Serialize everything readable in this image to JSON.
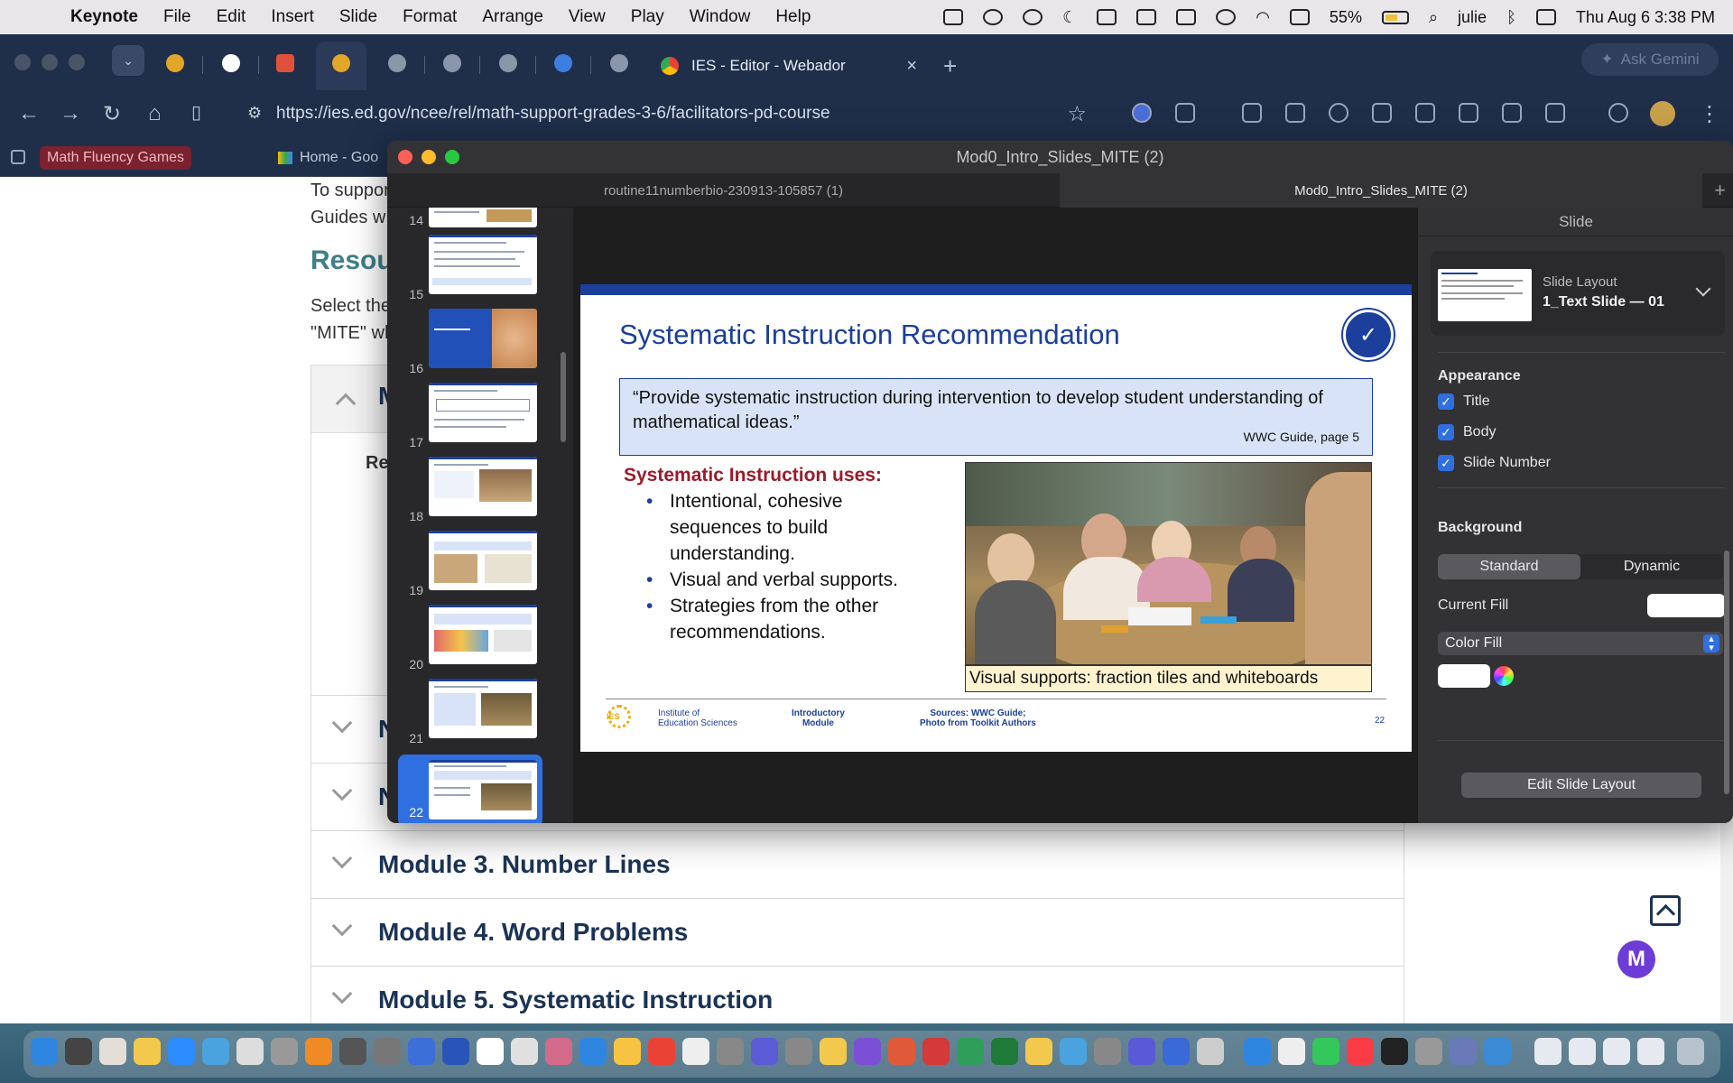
{
  "menubar": {
    "app": "Keynote",
    "items": [
      "File",
      "Edit",
      "Insert",
      "Slide",
      "Format",
      "Arrange",
      "View",
      "Play",
      "Window",
      "Help"
    ],
    "battery": "55%",
    "user": "julie",
    "datetime": "Thu Aug 6  3:38 PM"
  },
  "browser": {
    "active_tab_title": "IES - Editor - Webador",
    "ask_gemini": "Ask Gemini",
    "url": "https://ies.ed.gov/ncee/rel/math-support-grades-3-6/facilitators-pd-course",
    "bookmarks": [
      "Math Fluency Games",
      "Home - Goo"
    ]
  },
  "webpage": {
    "intro_line1": "To suppor",
    "intro_line2": "Guides w",
    "resources_heading": "Resou",
    "select_line1": "Select the",
    "select_line2": "\"MITE\" wh",
    "open_accordion_initial": "M",
    "open_body_initial": "Re",
    "collapsed_initials": [
      "N",
      "N"
    ],
    "modules": [
      "Module 3. Number Lines",
      "Module 4. Word Problems",
      "Module 5. Systematic Instruction"
    ],
    "help_bubble": "M"
  },
  "keynote": {
    "window_title": "Mod0_Intro_Slides_MITE (2)",
    "tabs": [
      "routine11numberbio-230913-105857 (1)",
      "Mod0_Intro_Slides_MITE (2)"
    ],
    "slide_numbers": [
      "14",
      "15",
      "16",
      "17",
      "18",
      "19",
      "20",
      "21",
      "22"
    ],
    "selected_slide": "22",
    "slide": {
      "title": "Systematic Instruction Recommendation",
      "quote": "“Provide systematic instruction during intervention to develop student understanding of mathematical ideas.”",
      "quote_source": "WWC Guide, page 5",
      "uses_heading": "Systematic Instruction uses:",
      "bullets": [
        "Intentional, cohesive sequences to build understanding.",
        "Visual and verbal supports.",
        "Strategies from the other recommendations."
      ],
      "photo_caption": "Visual supports: fraction tiles and whiteboards",
      "footer_logo_abbr": "IES",
      "footer_org": "Institute of\nEducation Sciences",
      "footer_module": "Introductory\nModule",
      "footer_sources": "Sources: WWC Guide;\nPhoto from Toolkit Authors",
      "page_number": "22"
    },
    "inspector": {
      "header": "Slide",
      "layout_label": "Slide Layout",
      "layout_value": "1_Text Slide — 01",
      "appearance": "Appearance",
      "checks": [
        "Title",
        "Body",
        "Slide Number"
      ],
      "background": "Background",
      "seg": [
        "Standard",
        "Dynamic"
      ],
      "current_fill": "Current Fill",
      "fill_type": "Color Fill",
      "edit_layout": "Edit Slide Layout"
    }
  },
  "colors": {
    "slide_blue": "#1b3f9a",
    "uses_red": "#9b1b2a",
    "selection_blue": "#2f6fe0"
  }
}
